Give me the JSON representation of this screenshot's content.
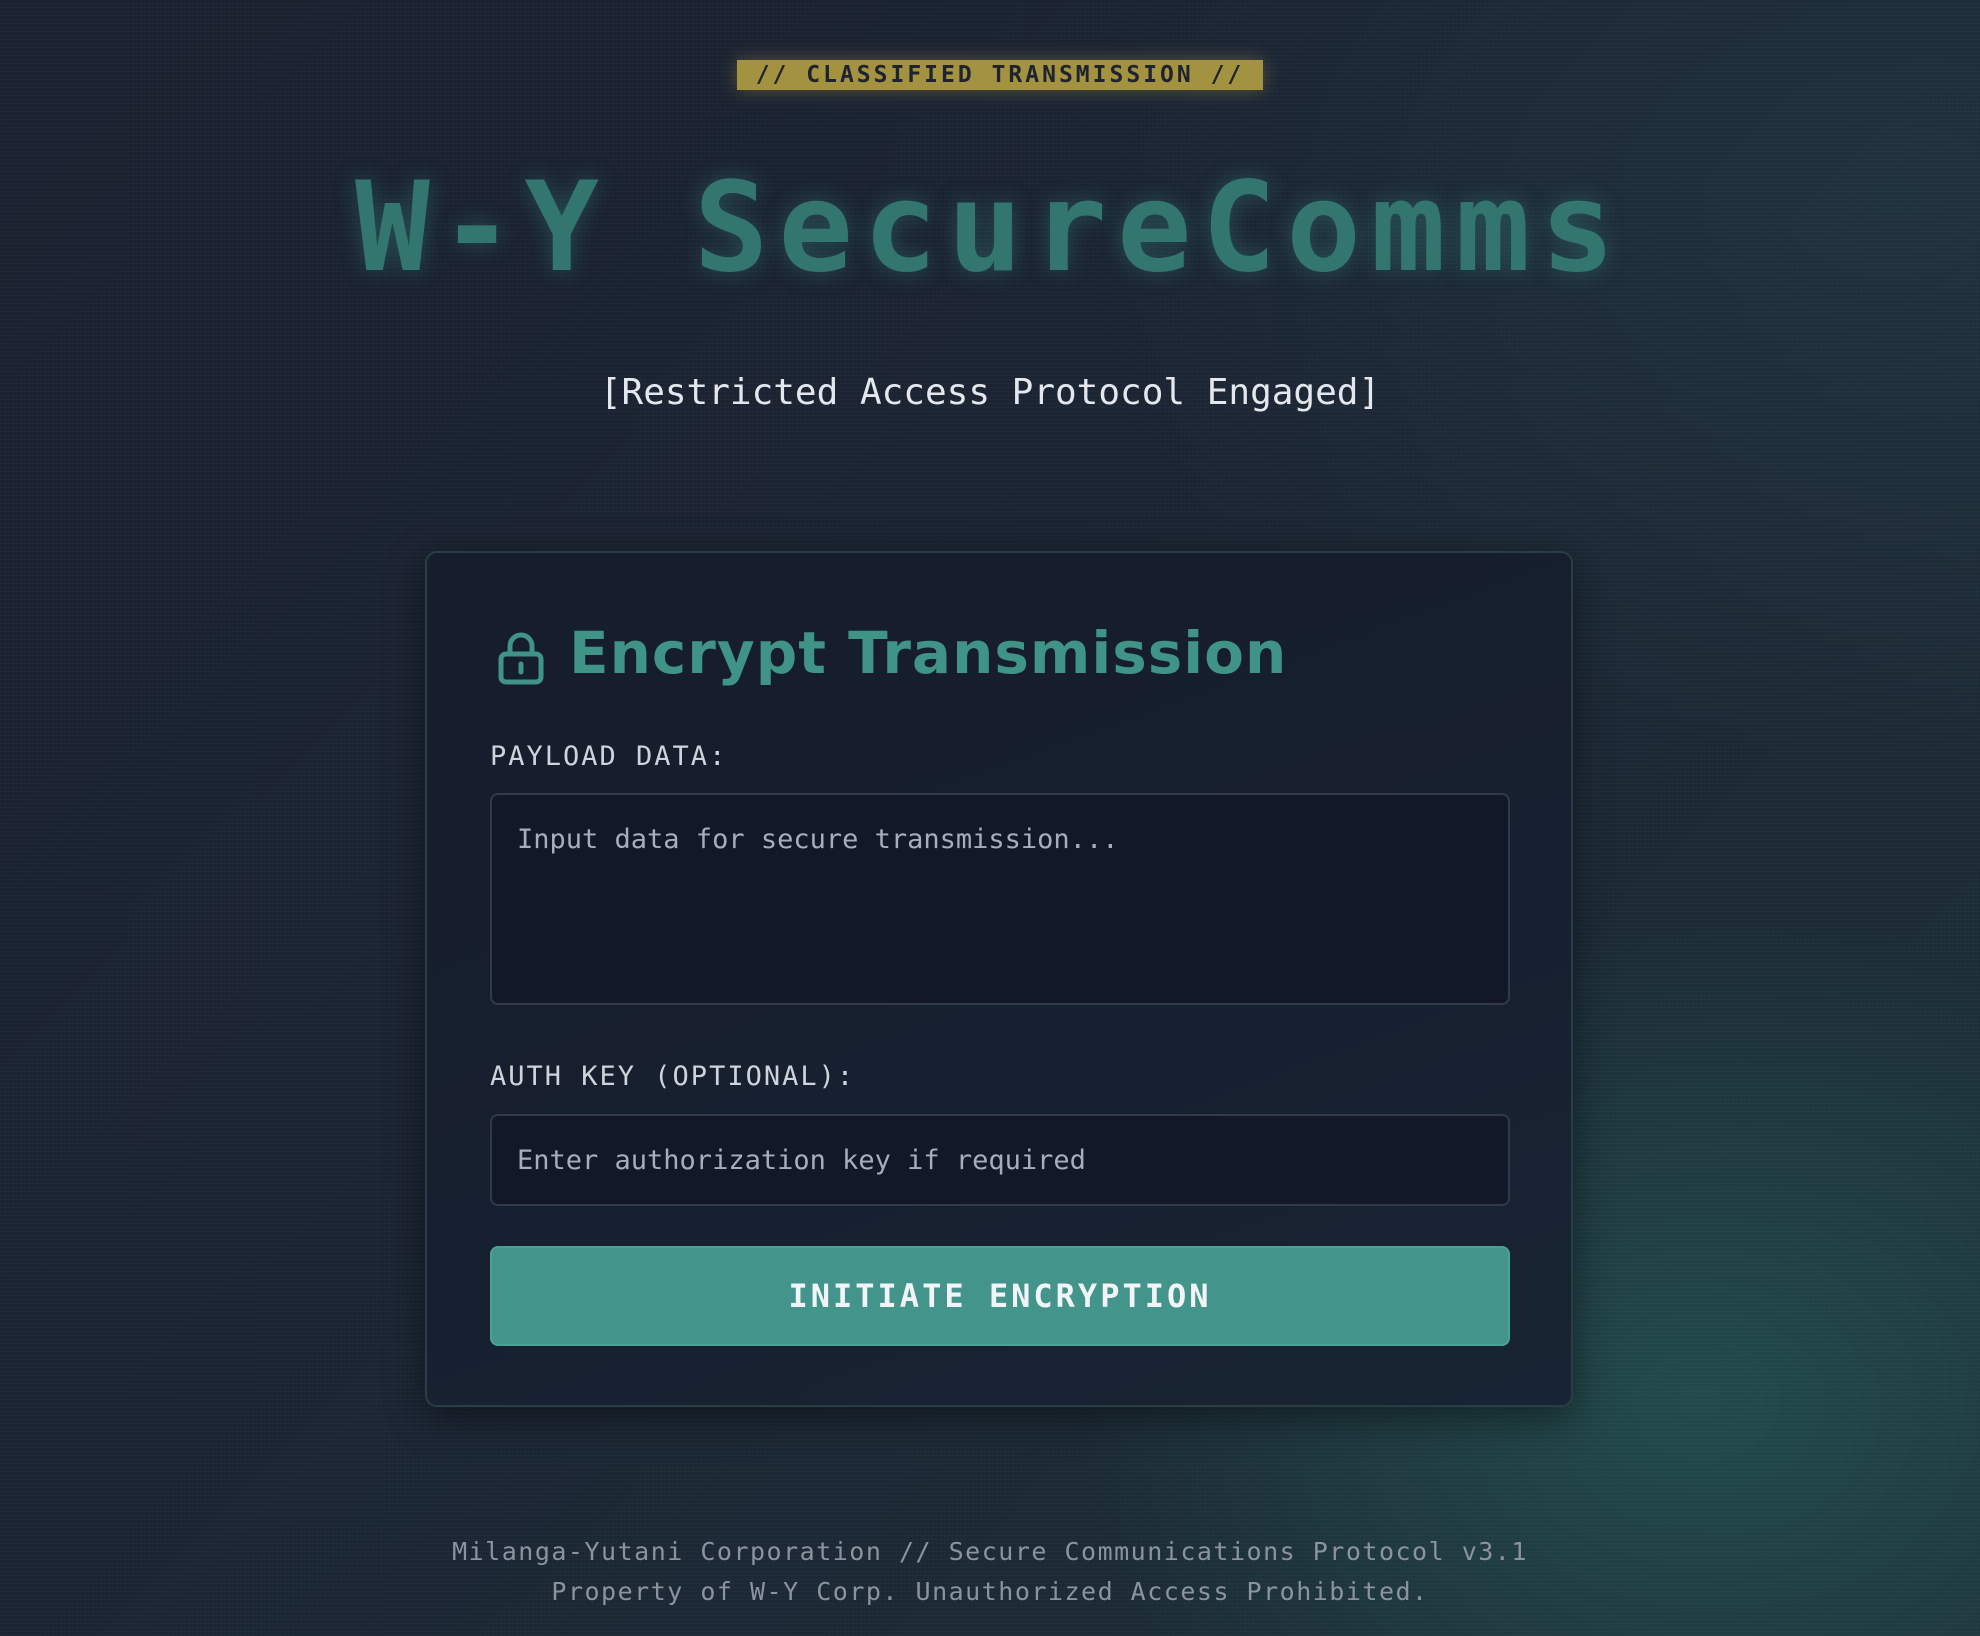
{
  "header": {
    "badge": "// CLASSIFIED TRANSMISSION //",
    "title": "W-Y SecureComms",
    "subtitle": "[Restricted Access Protocol Engaged]"
  },
  "card": {
    "title": "Encrypt Transmission",
    "icon": "lock-icon",
    "payload": {
      "label": "PAYLOAD DATA:",
      "placeholder": "Input data for secure transmission...",
      "value": ""
    },
    "auth_key": {
      "label": "AUTH KEY (OPTIONAL):",
      "placeholder": "Enter authorization key if required",
      "value": ""
    },
    "submit_label": "INITIATE ENCRYPTION"
  },
  "footer": {
    "line1": "Milanga-Yutani Corporation // Secure Communications Protocol v3.1",
    "line2": "Property of W-Y Corp. Unauthorized Access Prohibited."
  },
  "colors": {
    "accent": "#43948a",
    "title": "#33766f",
    "badge": "#a3923f",
    "background": "#1a2130"
  }
}
